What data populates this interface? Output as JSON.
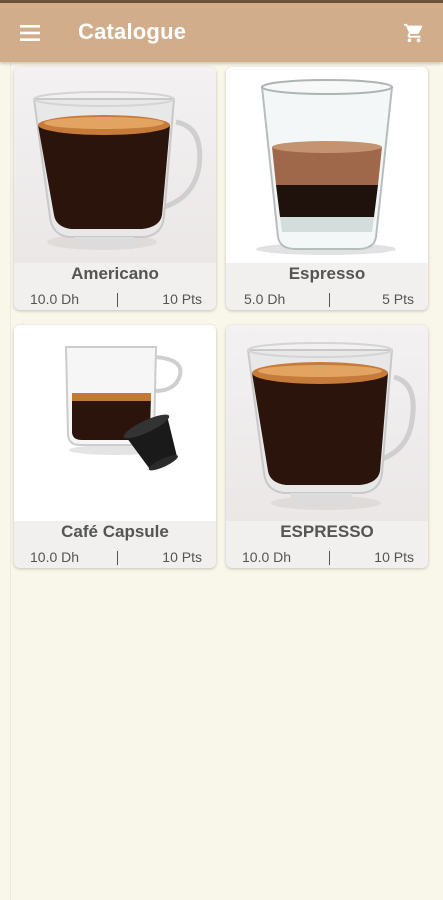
{
  "app_bar": {
    "title": "Catalogue",
    "menu_icon": "menu-icon",
    "cart_icon": "cart-icon"
  },
  "products": [
    {
      "name": "Americano",
      "price": "10.0 Dh",
      "points": "10 Pts",
      "image": "americano-cup-image"
    },
    {
      "name": "Espresso",
      "price": "5.0 Dh",
      "points": "5 Pts",
      "image": "espresso-glass-image"
    },
    {
      "name": "Café Capsule",
      "price": "10.0 Dh",
      "points": "10 Pts",
      "image": "cafe-capsule-image"
    },
    {
      "name": "ESPRESSO",
      "price": "10.0 Dh",
      "points": "10 Pts",
      "image": "espresso-cup-image"
    }
  ],
  "colors": {
    "app_bar": "#d1ad8b",
    "background": "#f9f6ea",
    "card": "#f1f0ee",
    "text": "#555555"
  }
}
